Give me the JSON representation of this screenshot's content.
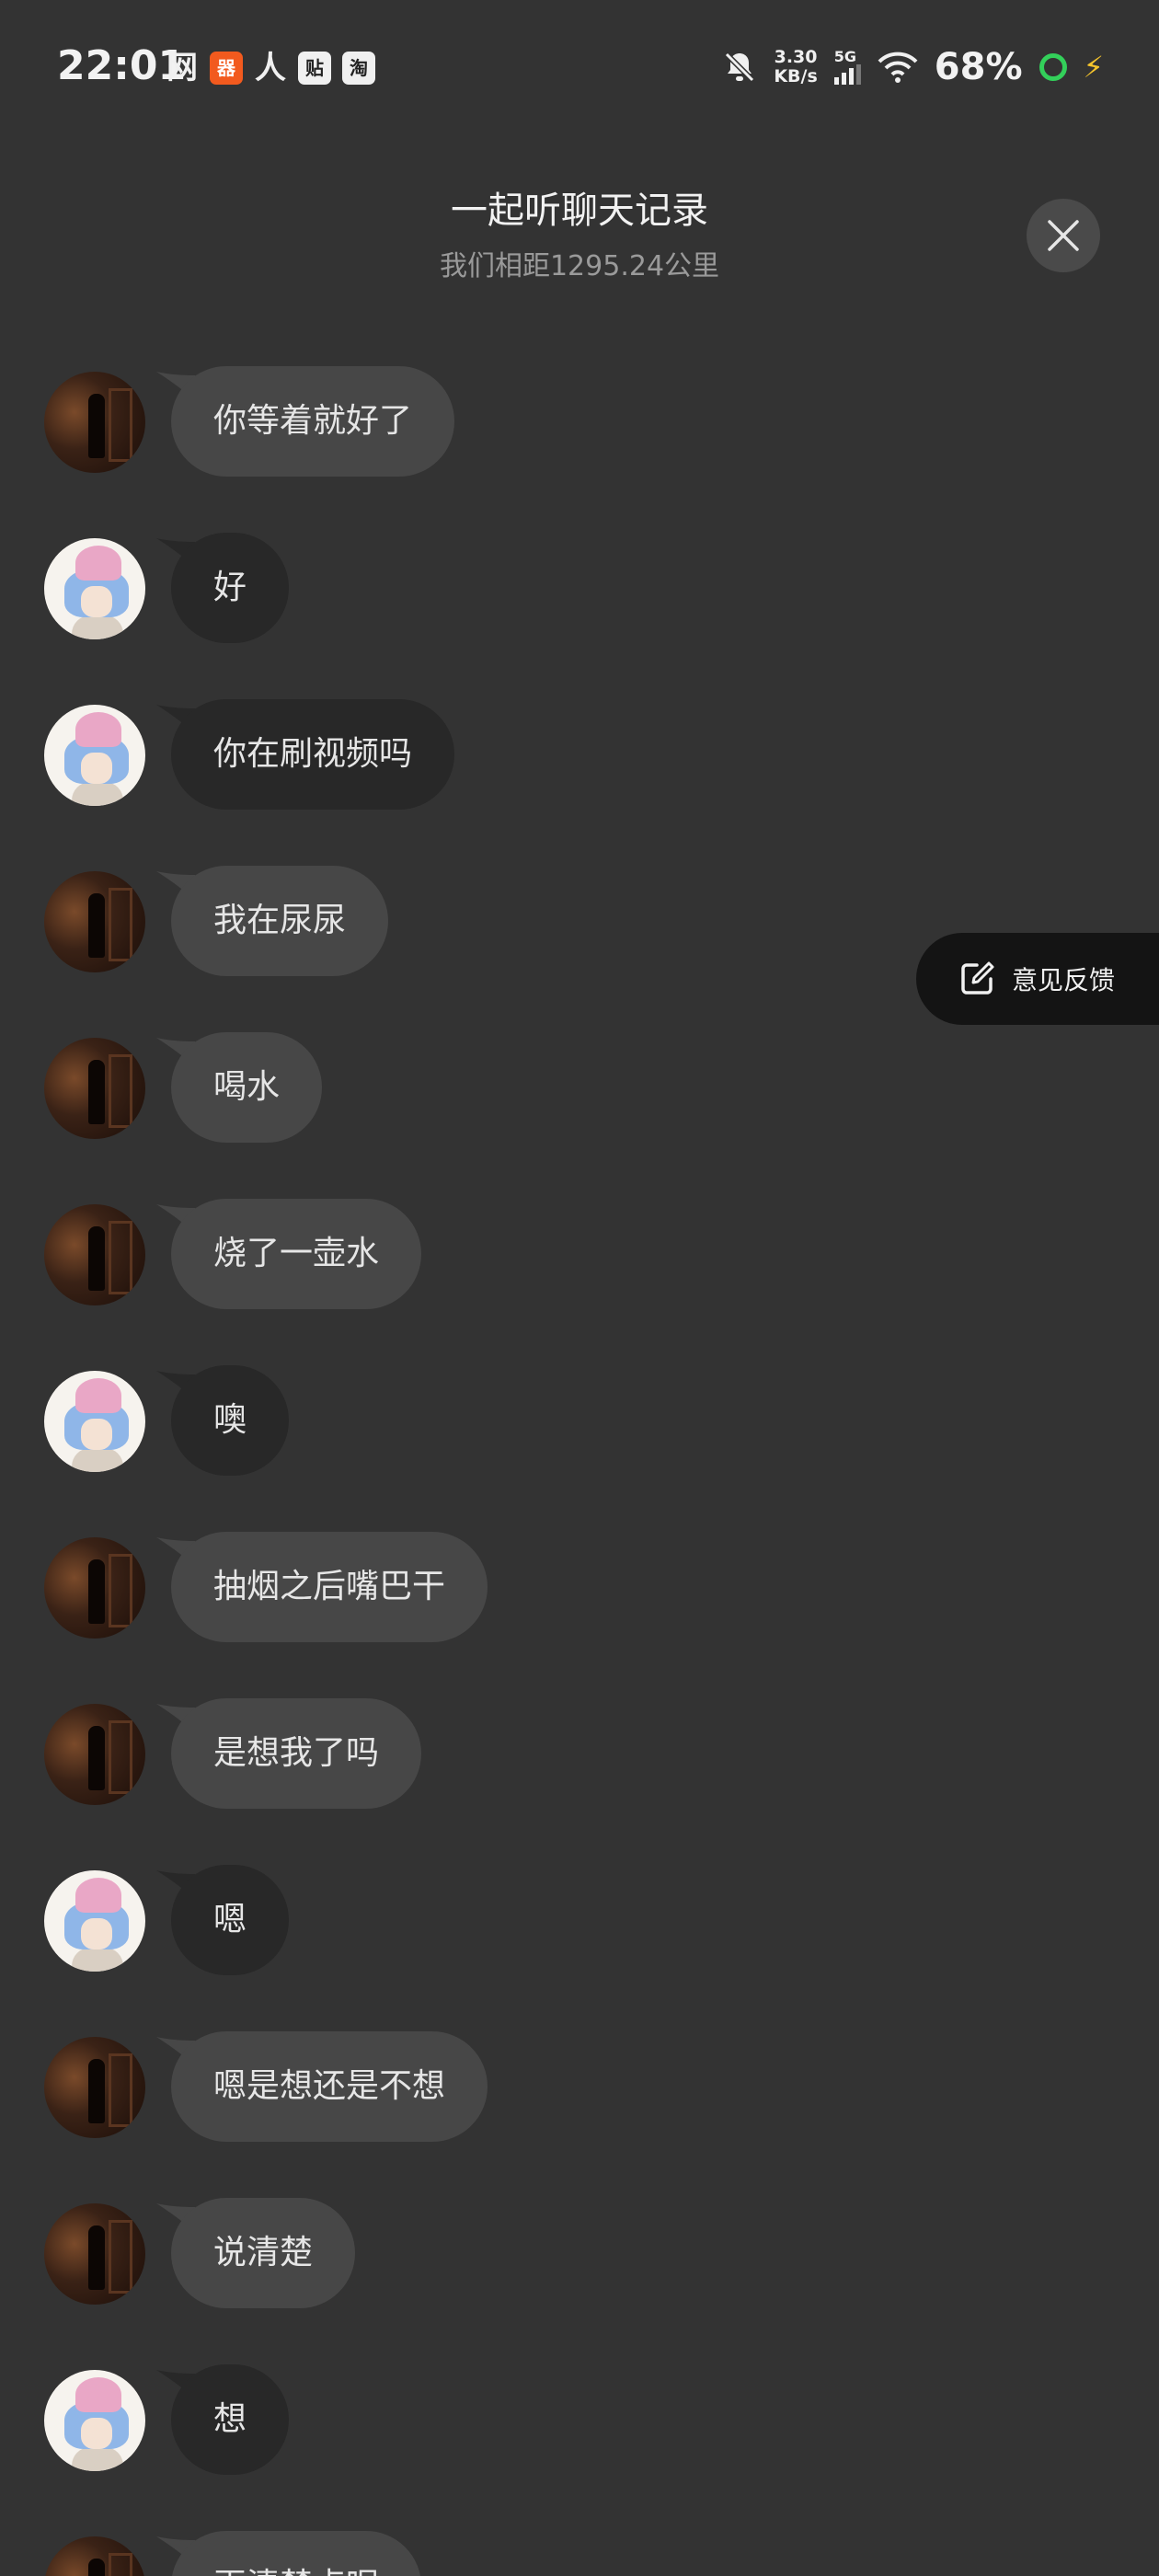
{
  "status_bar": {
    "time": "22:01",
    "app_icons": [
      "网",
      "器",
      "人",
      "贴",
      "淘"
    ],
    "net_speed_value": "3.30",
    "net_speed_unit": "KB/s",
    "signal_label": "5G",
    "battery": "68%",
    "colors": {
      "battery_ring": "#33d05a",
      "charge_bolt": "#f5c42c",
      "orange_app": "#f25a1e"
    }
  },
  "header": {
    "title": "一起听聊天记录",
    "subtitle": "我们相距1295.24公里",
    "close_icon": "close-icon"
  },
  "feedback": {
    "label": "意见反馈",
    "icon": "edit-icon"
  },
  "messages": [
    {
      "sender": "dark",
      "text": "你等着就好了"
    },
    {
      "sender": "light",
      "text": "好"
    },
    {
      "sender": "light",
      "text": "你在刷视频吗"
    },
    {
      "sender": "dark",
      "text": "我在尿尿"
    },
    {
      "sender": "dark",
      "text": "喝水"
    },
    {
      "sender": "dark",
      "text": "烧了一壶水"
    },
    {
      "sender": "light",
      "text": "噢"
    },
    {
      "sender": "dark",
      "text": "抽烟之后嘴巴干"
    },
    {
      "sender": "dark",
      "text": "是想我了吗"
    },
    {
      "sender": "light",
      "text": "嗯"
    },
    {
      "sender": "dark",
      "text": "嗯是想还是不想"
    },
    {
      "sender": "dark",
      "text": "说清楚"
    },
    {
      "sender": "light",
      "text": "想"
    },
    {
      "sender": "dark",
      "text": "再清楚点呢"
    }
  ]
}
